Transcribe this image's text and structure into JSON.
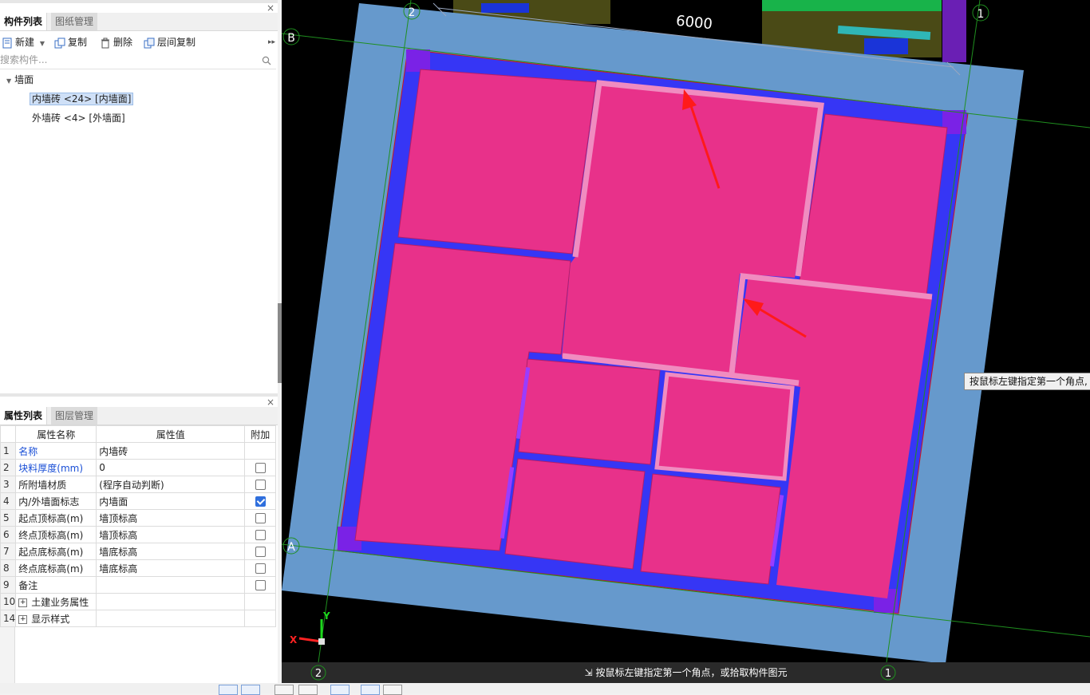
{
  "left_panel": {
    "top_tabs": [
      "构件列表",
      "图纸管理"
    ],
    "toolbar": {
      "new_label": "新建",
      "copy_label": "复制",
      "delete_label": "删除",
      "floor_copy_label": "层间复制"
    },
    "search": {
      "placeholder": "搜索构件..."
    },
    "tree": {
      "root": "墙面",
      "items": [
        "内墙砖 <24> [内墙面]",
        "外墙砖 <4> [外墙面]"
      ]
    },
    "bottom_tabs": [
      "属性列表",
      "图层管理"
    ],
    "properties": {
      "headers": [
        "属性名称",
        "属性值",
        "附加"
      ],
      "rows": [
        {
          "num": "1",
          "name": "名称",
          "value": "内墙砖",
          "checked": null,
          "blue": true
        },
        {
          "num": "2",
          "name": "块料厚度(mm)",
          "value": "0",
          "checked": false,
          "blue": true
        },
        {
          "num": "3",
          "name": "所附墙材质",
          "value": "(程序自动判断)",
          "checked": false,
          "blue": false
        },
        {
          "num": "4",
          "name": "内/外墙面标志",
          "value": "内墙面",
          "checked": true,
          "blue": false
        },
        {
          "num": "5",
          "name": "起点顶标高(m)",
          "value": "墙顶标高",
          "checked": false,
          "blue": false
        },
        {
          "num": "6",
          "name": "终点顶标高(m)",
          "value": "墙顶标高",
          "checked": false,
          "blue": false
        },
        {
          "num": "7",
          "name": "起点底标高(m)",
          "value": "墙底标高",
          "checked": false,
          "blue": false
        },
        {
          "num": "8",
          "name": "终点底标高(m)",
          "value": "墙底标高",
          "checked": false,
          "blue": false
        },
        {
          "num": "9",
          "name": "备注",
          "value": "",
          "checked": false,
          "blue": false
        },
        {
          "num": "10",
          "name": "土建业务属性",
          "value": "",
          "checked": null,
          "blue": false,
          "expand": true
        },
        {
          "num": "14",
          "name": "显示样式",
          "value": "",
          "checked": null,
          "blue": false,
          "expand": true
        }
      ]
    }
  },
  "viewport": {
    "dimension_label": "6000",
    "axis_labels": {
      "b": "B",
      "a": "A",
      "one_top": "1",
      "one_bottom": "1",
      "two_top": "2",
      "two_bottom": "2"
    },
    "coord_x": "X",
    "coord_y": "Y",
    "tooltip": "按鼠标左键指定第一个角点,",
    "command_prompt": "按鼠标左键指定第一个角点，或拾取构件图元"
  },
  "colors": {
    "room_fill": "#e8318a",
    "wall_blue": "#3636f5",
    "slab_blue": "#6699cc",
    "highlight_pink": "#f08cc0",
    "arrow_red": "#ff1a1a"
  }
}
